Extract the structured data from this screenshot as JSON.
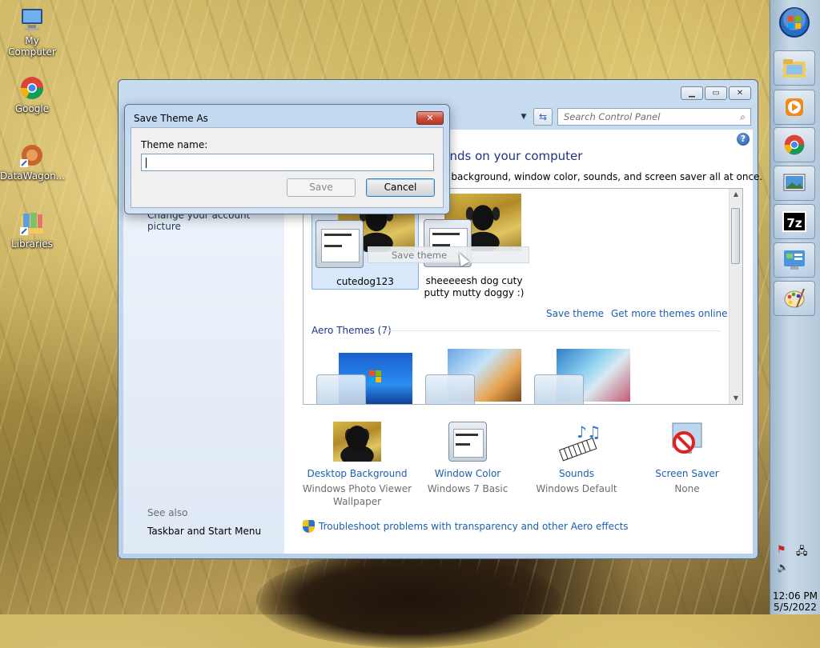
{
  "desktop": {
    "icons": [
      {
        "label": "My Computer"
      },
      {
        "label": "Google"
      },
      {
        "label": "DataWagon..."
      },
      {
        "label": "Libraries"
      }
    ]
  },
  "dialog": {
    "title": "Save Theme As",
    "field_label": "Theme name:",
    "field_value": "",
    "save_label": "Save",
    "cancel_label": "Cancel",
    "close_glyph": "✕"
  },
  "window": {
    "search_placeholder": "Search Control Panel",
    "title": "unds on your computer",
    "subtitle": "p background, window color, sounds, and screen saver all at once.",
    "left_pane": {
      "link_account_picture": "Change your account picture",
      "see_also": "See also",
      "taskbar_link": "Taskbar and Start Menu"
    },
    "themes": {
      "my_themes": [
        {
          "name": "cutedog123",
          "selected": true
        },
        {
          "name": "sheeeeesh dog cuty putty mutty doggy :)",
          "selected": false
        }
      ],
      "tooltip": "Save theme",
      "save_theme_link": "Save theme",
      "more_themes_link": "Get more themes online",
      "aero_heading": "Aero Themes (7)"
    },
    "bottom": [
      {
        "label": "Desktop Background",
        "value": "Windows Photo Viewer Wallpaper"
      },
      {
        "label": "Window Color",
        "value": "Windows 7 Basic"
      },
      {
        "label": "Sounds",
        "value": "Windows Default"
      },
      {
        "label": "Screen Saver",
        "value": "None"
      }
    ],
    "troubleshoot_link": "Troubleshoot problems with transparency and other Aero effects"
  },
  "taskbar": {
    "time": "12:06 PM",
    "date": "5/5/2022",
    "app_7zip": "7z"
  },
  "colors": {
    "link": "#1c5fae",
    "heading": "#1e3287"
  }
}
